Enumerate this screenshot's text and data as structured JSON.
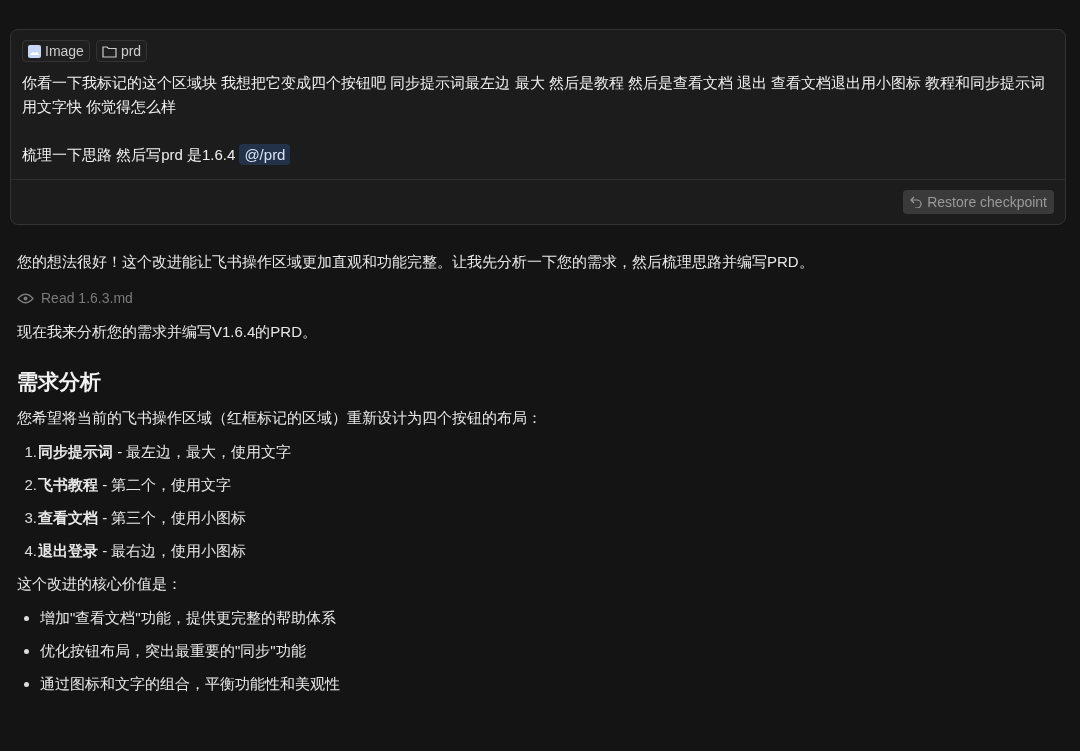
{
  "user_message": {
    "attachments": [
      {
        "kind": "image",
        "label": "Image"
      },
      {
        "kind": "folder",
        "label": "prd"
      }
    ],
    "paragraphs": [
      {
        "text": "你看一下我标记的这个区域块 我想把它变成四个按钮吧  同步提示词最左边 最大 然后是教程  然后是查看文档 退出  查看文档退出用小图标 教程和同步提示词用文字快 你觉得怎么样"
      },
      {
        "text": "梳理一下思路 然后写prd  是1.6.4",
        "mention": "@/prd"
      }
    ],
    "restore_button": "Restore checkpoint"
  },
  "response": [
    {
      "kind": "text",
      "text": "您的想法很好！这个改进能让飞书操作区域更加直观和功能完整。让我先分析一下您的需求，然后梳理思路并编写PRD。"
    },
    {
      "kind": "tool",
      "text": "Read 1.6.3.md"
    },
    {
      "kind": "text",
      "text": "现在我来分析您的需求并编写V1.6.4的PRD。"
    },
    {
      "kind": "heading",
      "text": "需求分析"
    },
    {
      "kind": "text",
      "text": "您希望将当前的飞书操作区域（红框标记的区域）重新设计为四个按钮的布局："
    },
    {
      "kind": "ordered",
      "items": [
        {
          "marker": "1.",
          "text": "**同步提示词** - 最左边，最大，使用文字"
        },
        {
          "marker": "2.",
          "text": "**飞书教程** - 第二个，使用文字"
        },
        {
          "marker": "3.",
          "text": "**查看文档** - 第三个，使用小图标"
        },
        {
          "marker": "4.",
          "text": "**退出登录** - 最右边，使用小图标"
        }
      ]
    },
    {
      "kind": "text",
      "text": "这个改进的核心价值是："
    },
    {
      "kind": "bullets",
      "items": [
        {
          "text": "增加\"查看文档\"功能，提供更完整的帮助体系"
        },
        {
          "text": "优化按钮布局，突出最重要的\"同步\"功能"
        },
        {
          "text": "通过图标和文字的组合，平衡功能性和美观性"
        }
      ]
    }
  ]
}
